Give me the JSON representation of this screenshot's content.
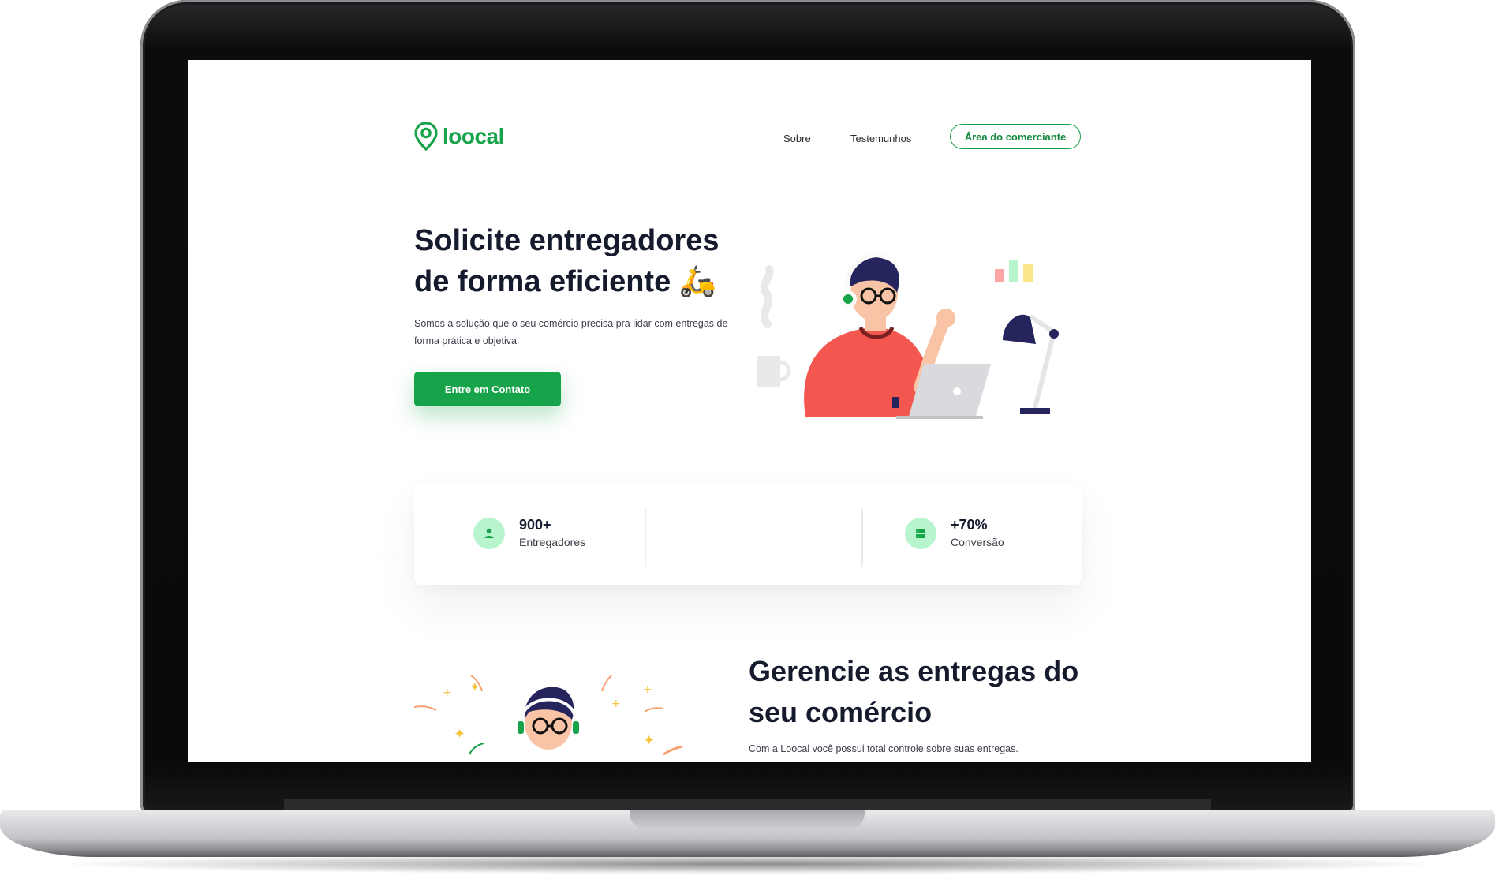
{
  "brand": {
    "name": "loocal",
    "color": "#17a34a"
  },
  "nav": {
    "links": [
      "Sobre",
      "Testemunhos"
    ],
    "cta_label": "Área do comerciante"
  },
  "hero": {
    "title_line1": "Solicite entregadores",
    "title_line2": "de forma eficiente",
    "title_emoji": "🛵",
    "subtitle": "Somos a solução que o seu comércio precisa pra lidar com entregas de forma prática e objetiva.",
    "cta_label": "Entre em Contato"
  },
  "stats": [
    {
      "value": "900+",
      "label": "Entregadores",
      "icon": "user-icon"
    },
    {
      "value": "+70%",
      "label": "Conversão",
      "icon": "server-icon"
    }
  ],
  "section2": {
    "title": "Gerencie as entregas do seu comércio",
    "subtitle": "Com a Loocal você possui total controle sobre suas entregas."
  },
  "colors": {
    "accent": "#17a34a",
    "icon_bg": "#b8f5cf",
    "heading": "#151a2d"
  }
}
